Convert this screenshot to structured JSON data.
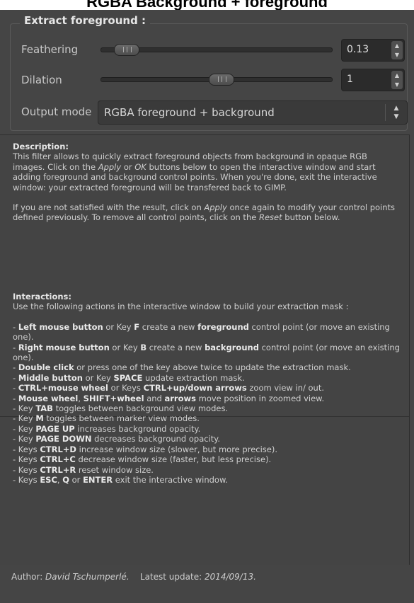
{
  "caption": "RGBA Background + foreground",
  "group": {
    "title": "Extract foreground :"
  },
  "feathering": {
    "label": "Feathering",
    "value": "0.13",
    "level_fraction": 0.06
  },
  "dilation": {
    "label": "Dilation",
    "value": "1",
    "level_fraction": 0.52
  },
  "output_mode": {
    "label": "Output mode",
    "value": "RGBA foreground + background"
  },
  "description": {
    "heading": "Description:",
    "p1_a": " This filter allows to quickly extract foreground objects from background in opaque RGB images. Click on the ",
    "p1_apply": "Apply",
    "p1_b": " or ",
    "p1_ok": "OK",
    "p1_c": " buttons below to open the interactive window and start adding foreground and background control points. When you're done, exit the interactive window: your extracted foreground will be transfered back to GIMP.",
    "p2_a": " If you are not satisfied with the result, click on ",
    "p2_apply": "Apply",
    "p2_b": " once again to modify your control points defined previously. To remove all control points, click on the ",
    "p2_reset": "Reset",
    "p2_c": " button below."
  },
  "interactions": {
    "heading": "Interactions:",
    "intro": " Use the following actions in the interactive window to build your extraction mask :",
    "i1_a": " - ",
    "i1_b": "Left mouse button",
    "i1_c": " or Key ",
    "i1_d": "F",
    "i1_e": " create a new ",
    "i1_f": "foreground",
    "i1_g": " control point (or move an existing one).",
    "i2_a": " - ",
    "i2_b": "Right mouse button",
    "i2_c": " or Key ",
    "i2_d": "B",
    "i2_e": " create a new ",
    "i2_f": "background",
    "i2_g": " control point (or move an existing one).",
    "i3_a": " - ",
    "i3_b": "Double click",
    "i3_c": " or press one of the key above twice to update the extraction mask.",
    "i4_a": " - ",
    "i4_b": "Middle button",
    "i4_c": " or Key ",
    "i4_d": "SPACE",
    "i4_e": " update extraction mask.",
    "i5_a": " - ",
    "i5_b": "CTRL+mouse wheel",
    "i5_c": " or Keys ",
    "i5_d": "CTRL+up/down arrows",
    "i5_e": " zoom view in/ out.",
    "i6_a": " - ",
    "i6_b": "Mouse wheel",
    "i6_c": ", ",
    "i6_d": "SHIFT+wheel",
    "i6_e": " and ",
    "i6_f": "arrows",
    "i6_g": " move position in zoomed view.",
    "i7_a": " - Key ",
    "i7_b": "TAB",
    "i7_c": " toggles between background view modes.",
    "i8_a": " - Key ",
    "i8_b": "M",
    "i8_c": " toggles between marker view modes.",
    "i9_a": " - Key ",
    "i9_b": "PAGE UP",
    "i9_c": " increases background opacity.",
    "i10_a": " - Key ",
    "i10_b": "PAGE DOWN",
    "i10_c": " decreases background opacity.",
    "i11_a": " - Keys ",
    "i11_b": "CTRL+D",
    "i11_c": " increase window size (slower, but more precise).",
    "i12_a": " - Keys ",
    "i12_b": "CTRL+C",
    "i12_c": " decrease window size (faster, but less precise).",
    "i13_a": " - Keys ",
    "i13_b": "CTRL+R",
    "i13_c": " reset window size.",
    "i14_a": " - Keys ",
    "i14_b": "ESC",
    "i14_c": ", ",
    "i14_d": "Q",
    "i14_e": " or ",
    "i14_f": "ENTER",
    "i14_g": " exit the interactive window."
  },
  "footer": {
    "author_label": "Author: ",
    "author_name": "David Tschumperlé.",
    "update_label": "Latest update: ",
    "update_date": "2014/09/13."
  }
}
